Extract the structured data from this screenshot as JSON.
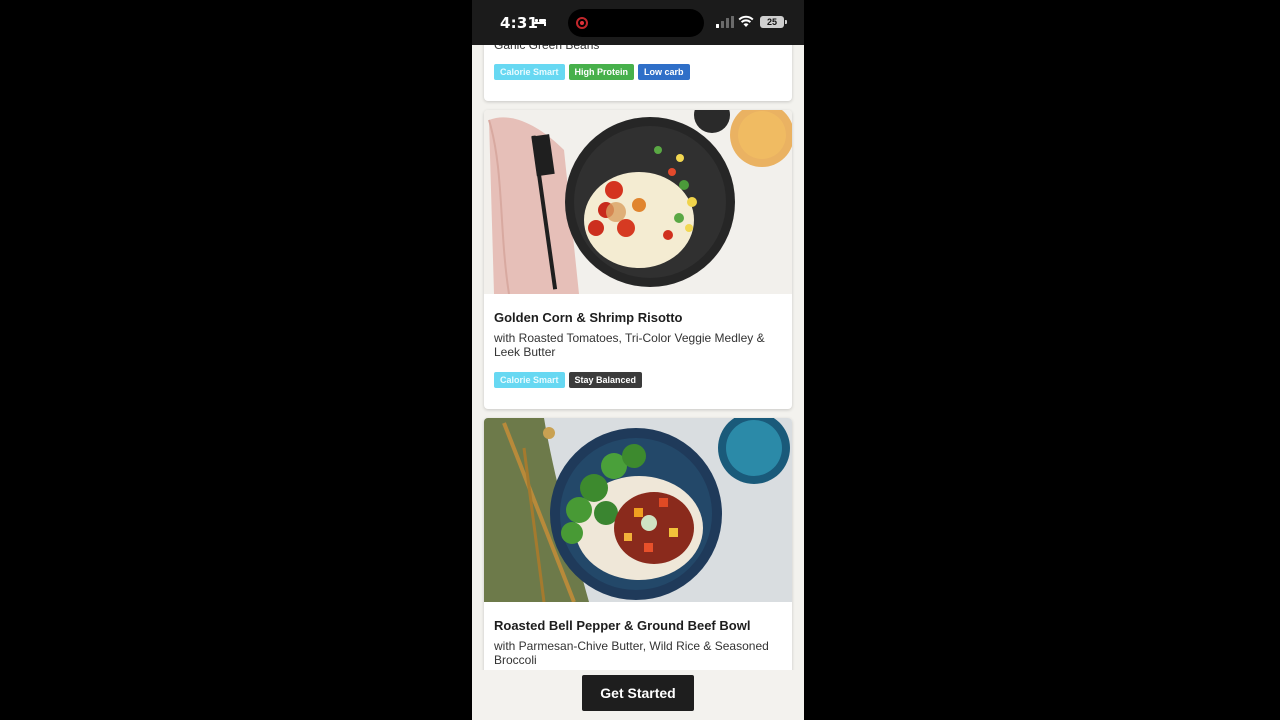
{
  "status_bar": {
    "time": "4:31",
    "battery": "25",
    "icons": [
      "bed-icon",
      "screen-record-icon",
      "signal-icon",
      "wifi-icon",
      "battery-icon"
    ]
  },
  "recipes": [
    {
      "subtitle_partial": "Garlic Green Beans",
      "tags": [
        "Calorie Smart",
        "High Protein",
        "Low carb"
      ]
    },
    {
      "title": "Golden Corn & Shrimp Risotto",
      "subtitle": "with Roasted Tomatoes, Tri-Color Veggie Medley & Leek Butter",
      "tags": [
        "Calorie Smart",
        "Stay Balanced"
      ]
    },
    {
      "title": "Roasted Bell Pepper & Ground Beef Bowl",
      "subtitle": "with Parmesan-Chive Butter, Wild Rice & Seasoned Broccoli"
    }
  ],
  "cta": {
    "label": "Get Started"
  },
  "colors": {
    "tag_calorie_smart": "#67d8f2",
    "tag_high_protein": "#47b04b",
    "tag_low_carb": "#2f6fc8",
    "tag_stay_balanced": "#3b3b3b",
    "cta_background": "#1e1e1e",
    "page_background": "#f3f2ee"
  }
}
